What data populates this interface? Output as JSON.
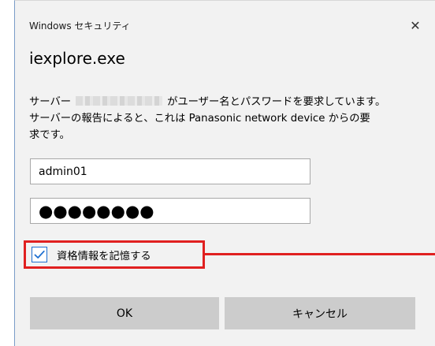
{
  "dialog": {
    "window_title": "Windows セキュリティ",
    "close_glyph": "✕",
    "app_name": "iexplore.exe",
    "message": {
      "line1_prefix": "サーバー",
      "line1_suffix": "がユーザー名とパスワードを要求しています。",
      "line2": "サーバーの報告によると、これは Panasonic network device からの要",
      "line3": "求です。"
    },
    "username": {
      "value": "admin01"
    },
    "password": {
      "masked_value": "●●●●●●●●"
    },
    "remember": {
      "label": "資格情報を記憶する",
      "checked": true
    },
    "ok_label": "OK",
    "cancel_label": "キャンセル"
  },
  "colors": {
    "dialog_background": "#f2f2f2",
    "button_background": "#cccccc",
    "checkbox_accent": "#1e6fd0",
    "callout_red": "#e02020"
  },
  "icons": {
    "close": "close-icon",
    "check": "checkmark-icon"
  }
}
